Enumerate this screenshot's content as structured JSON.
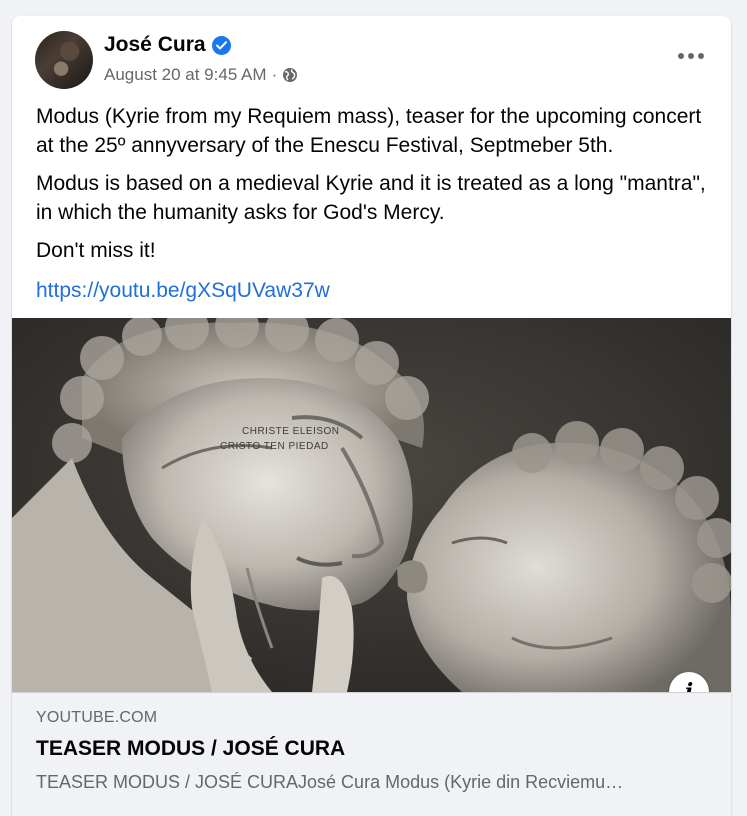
{
  "post": {
    "author": "José Cura",
    "timestamp": "August 20 at 9:45 AM",
    "separator": "·",
    "privacy_icon": "globe-icon",
    "paragraphs": [
      "Modus (Kyrie from my Requiem mass), teaser for the upcoming concert at the 25º annyversary of the Enescu Festival, Septmeber 5th.",
      "Modus is based on a medieval Kyrie and it is treated as a long \"mantra\", in which the humanity asks for God's Mercy.",
      "Don't miss it!"
    ],
    "link": "https://youtu.be/gXSqUVaw37w"
  },
  "media": {
    "overlay_line1": "CHRISTE ELEISON",
    "overlay_line2": "CRISTO TEN PIEDAD",
    "info_label": "i"
  },
  "preview": {
    "domain": "YOUTUBE.COM",
    "title": "TEASER MODUS / JOSÉ CURA",
    "description": "TEASER MODUS / JOSÉ CURAJosé Cura Modus (Kyrie din Recviemu…"
  },
  "colors": {
    "link": "#216fdb",
    "verified": "#1877f2",
    "secondary_text": "#65676b"
  }
}
